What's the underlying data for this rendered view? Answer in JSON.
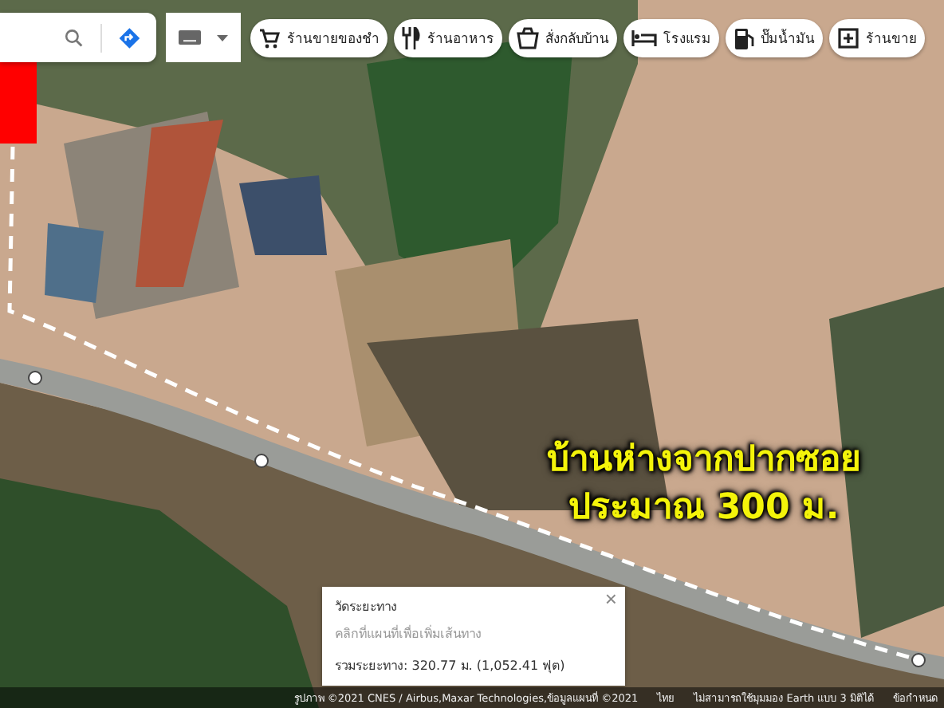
{
  "chips": [
    {
      "kind": "grocery",
      "label": "ร้านขายของชำ"
    },
    {
      "kind": "restaurant",
      "label": "ร้านอาหาร"
    },
    {
      "kind": "takeout",
      "label": "สั่งกลับบ้าน"
    },
    {
      "kind": "hotel",
      "label": "โรงแรม"
    },
    {
      "kind": "fuel",
      "label": "ปั๊มน้ำมัน"
    },
    {
      "kind": "shop",
      "label": "ร้านขาย"
    }
  ],
  "overlay_text": [
    "บ้านห่างจากปากซอย",
    "ประมาณ 300 ม."
  ],
  "measure": {
    "title": "วัดระยะทาง",
    "hint": "คลิกที่แผนที่เพื่อเพิ่มเส้นทาง",
    "total": "รวมระยะทาง: 320.77 ม. (1,052.41 ฟุต)",
    "close": "×"
  },
  "footer": [
    "รูปภาพ ©2021 CNES / Airbus,Maxar Technologies,ข้อมูลแผนที่ ©2021",
    "ไทย",
    "ไม่สามารถใช้มุมมอง Earth แบบ 3 มิติได้",
    "ข้อกำหนด"
  ]
}
